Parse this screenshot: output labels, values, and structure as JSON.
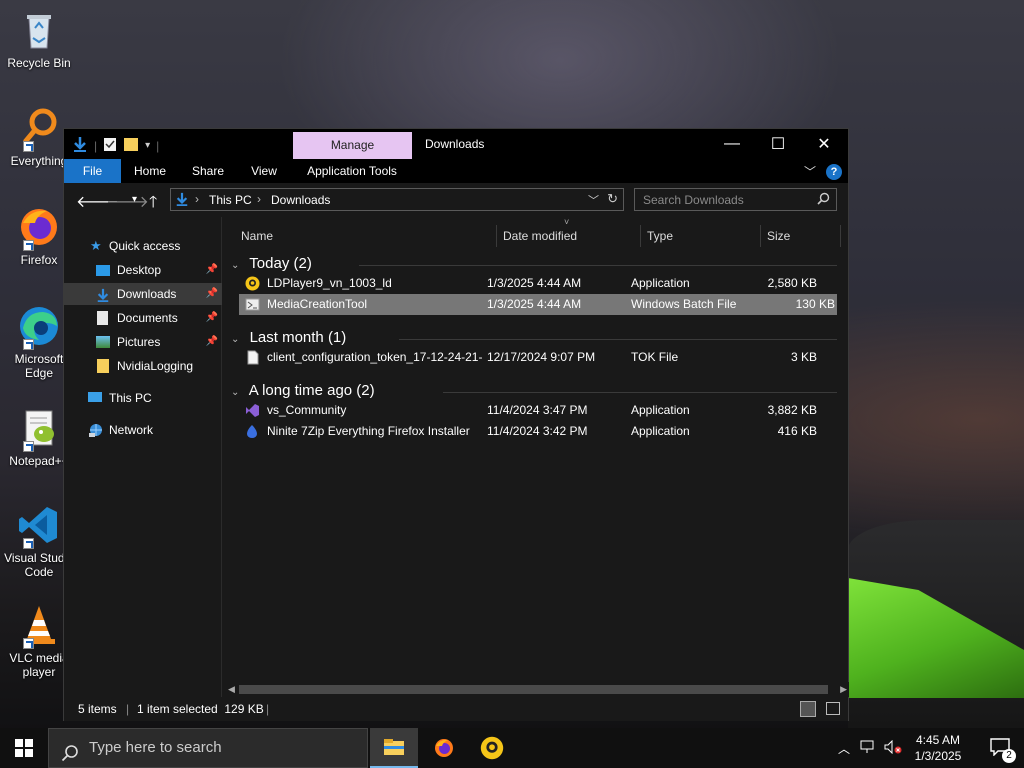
{
  "desktop": {
    "icons": [
      {
        "label": "Recycle Bin"
      },
      {
        "label": "Everything"
      },
      {
        "label": "Firefox"
      },
      {
        "label": "Microsoft Edge"
      },
      {
        "label": "Notepad++"
      },
      {
        "label": "Visual Studio Code"
      },
      {
        "label": "VLC media player"
      }
    ]
  },
  "window": {
    "title": "Downloads",
    "manage_tab": "Manage",
    "ribbon_tabs": [
      "File",
      "Home",
      "Share",
      "View",
      "Application Tools"
    ],
    "address": {
      "crumbs": [
        "This PC",
        "Downloads"
      ]
    },
    "search_placeholder": "Search Downloads",
    "controls": {
      "minimize": "—",
      "maximize": "☐",
      "close": "✕"
    }
  },
  "sidebar": {
    "items": [
      {
        "label": "Quick access"
      },
      {
        "label": "Desktop",
        "pinned": true
      },
      {
        "label": "Downloads",
        "pinned": true,
        "selected": true
      },
      {
        "label": "Documents",
        "pinned": true
      },
      {
        "label": "Pictures",
        "pinned": true
      },
      {
        "label": "NvidiaLogging"
      },
      {
        "label": "This PC"
      },
      {
        "label": "Network"
      }
    ]
  },
  "columns": [
    "Name",
    "Date modified",
    "Type",
    "Size"
  ],
  "groups": [
    {
      "label": "Today (2)",
      "files": [
        {
          "name": "LDPlayer9_vn_1003_ld",
          "date": "1/3/2025 4:44 AM",
          "type": "Application",
          "size": "2,580 KB"
        },
        {
          "name": "MediaCreationTool",
          "date": "1/3/2025 4:44 AM",
          "type": "Windows Batch File",
          "size": "130 KB",
          "selected": true
        }
      ]
    },
    {
      "label": "Last month (1)",
      "files": [
        {
          "name": "client_configuration_token_17-12-24-21-...",
          "date": "12/17/2024 9:07 PM",
          "type": "TOK File",
          "size": "3 KB"
        }
      ]
    },
    {
      "label": "A long time ago (2)",
      "files": [
        {
          "name": "vs_Community",
          "date": "11/4/2024 3:47 PM",
          "type": "Application",
          "size": "3,882 KB"
        },
        {
          "name": "Ninite 7Zip Everything Firefox Installer",
          "date": "11/4/2024 3:42 PM",
          "type": "Application",
          "size": "416 KB"
        }
      ]
    }
  ],
  "status": {
    "items": "5 items",
    "selected": "1 item selected  129 KB"
  },
  "taskbar": {
    "search_placeholder": "Type here to search",
    "time": "4:45 AM",
    "date": "1/3/2025",
    "notification_count": "2"
  },
  "colors": {
    "accent": "#1a73c8",
    "manage_tab": "#e6c5f2",
    "selection": "#777777"
  }
}
